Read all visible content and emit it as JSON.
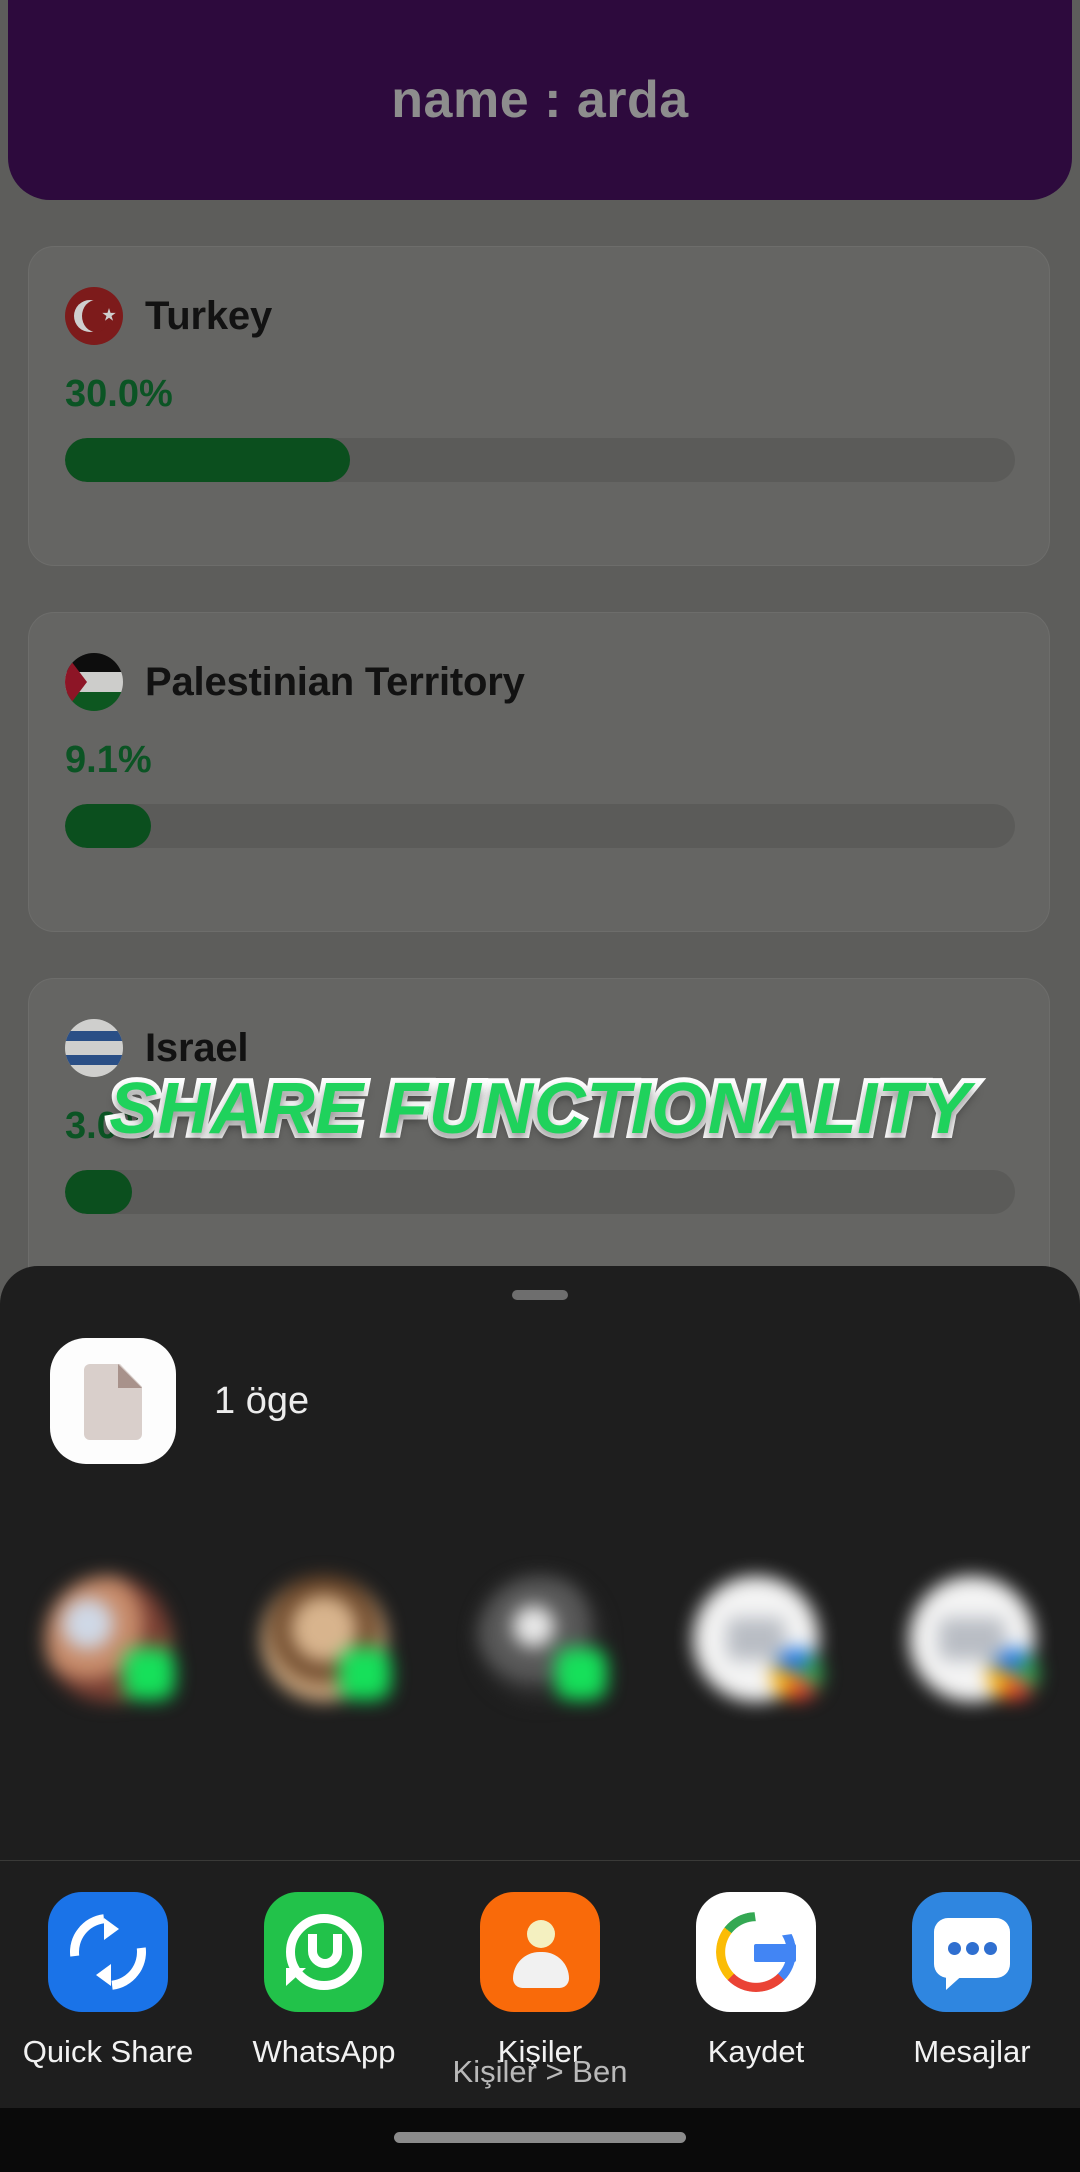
{
  "app": {
    "header_title": "name : arda",
    "header_bg": "#2d0a3d",
    "dim_bg": "#5d5d5b",
    "accent_green": "#0b4f1e"
  },
  "countries": [
    {
      "name": "Turkey",
      "percent_label": "30.0%",
      "percent_value": 30.0,
      "flag": "turkey-flag-icon"
    },
    {
      "name": "Palestinian Territory",
      "percent_label": "9.1%",
      "percent_value": 9.1,
      "flag": "palestine-flag-icon"
    },
    {
      "name": "Israel",
      "percent_label": "3.0%",
      "percent_value": 3.0,
      "flag": "israel-flag-icon"
    }
  ],
  "caption": {
    "text": "SHARE FUNCTIONALITY",
    "fill": "#1fd25c",
    "stroke": "#ffffff"
  },
  "share_sheet": {
    "item_count_label": "1 öge",
    "preview_icon": "document-file-icon",
    "contacts": [
      {
        "label": "",
        "badge": "whatsapp-badge-icon"
      },
      {
        "label": "",
        "badge": "whatsapp-badge-icon"
      },
      {
        "label": "",
        "badge": "whatsapp-badge-icon"
      },
      {
        "label": "",
        "badge": "google-badge-icon"
      },
      {
        "label": "",
        "badge": "google-badge-icon"
      }
    ],
    "apps": [
      {
        "label": "Quick Share",
        "icon": "quick-share-icon",
        "color": "#1a73e8"
      },
      {
        "label": "WhatsApp",
        "icon": "whatsapp-icon",
        "color": "#22c24a"
      },
      {
        "label": "Kişiler",
        "icon": "contacts-icon",
        "color": "#f96a0a"
      },
      {
        "label": "Kaydet",
        "icon": "google-icon",
        "color": "#ffffff"
      },
      {
        "label": "Mesajlar",
        "icon": "messages-icon",
        "color": "#2f86e0"
      }
    ],
    "footer_breadcrumb": "Kişiler > Ben"
  }
}
